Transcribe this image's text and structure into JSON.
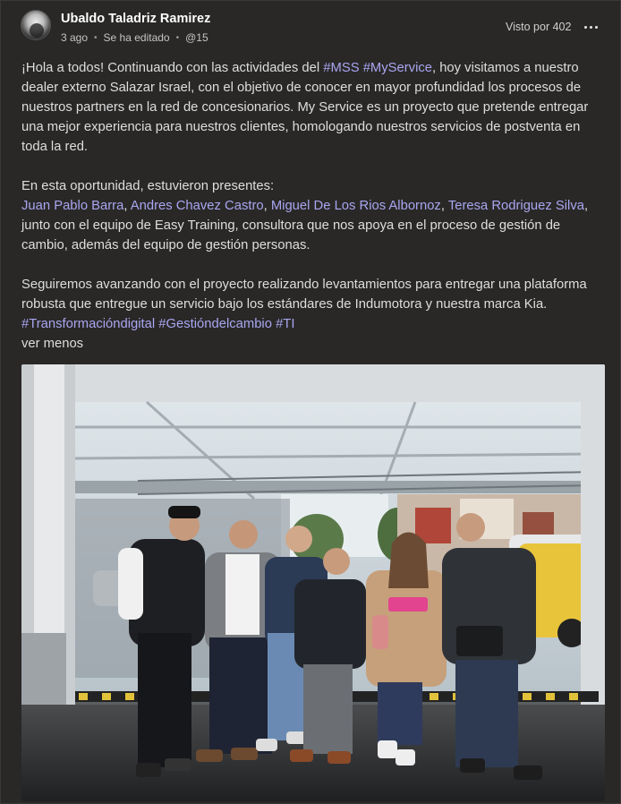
{
  "post": {
    "author": "Ubaldo Taladriz Ramirez",
    "time_ago": "3 ago",
    "edited": "Se ha editado",
    "mention_count": "@15",
    "seen_by": "Visto por 402"
  },
  "body": {
    "p1_a": "¡Hola a todos! Continuando con las actividades del ",
    "tag_mss": "#MSS",
    "tag_myservice": "#MyService",
    "p1_b": ", hoy visitamos a nuestro dealer externo Salazar Israel, con el objetivo de conocer en mayor profundidad los procesos de nuestros partners en la red de concesionarios. My Service es un proyecto que pretende entregar una mejor experiencia para nuestros clientes, homologando nuestros servicios de postventa en toda la red.",
    "p2_a": "En esta oportunidad, estuvieron presentes:",
    "m1": "Juan Pablo Barra",
    "m2": "Andres Chavez Castro",
    "m3": "Miguel De Los Rios Albornoz",
    "m4": "Teresa Rodriguez Silva",
    "sep": ", ",
    "p2_b": ", junto con el equipo de Easy Training, consultora que nos apoya en el proceso de gestión de cambio, además del equipo de gestión personas.",
    "p3_a": "Seguiremos avanzando con el proyecto realizando levantamientos para entregar una plataforma robusta que entregue un servicio bajo los estándares de Indumotora y nuestra marca Kia. ",
    "tag_td": "#Transformacióndigital",
    "tag_gc": "#Gestióndelcambio",
    "tag_ti": "#TI",
    "see_less": "ver menos"
  }
}
